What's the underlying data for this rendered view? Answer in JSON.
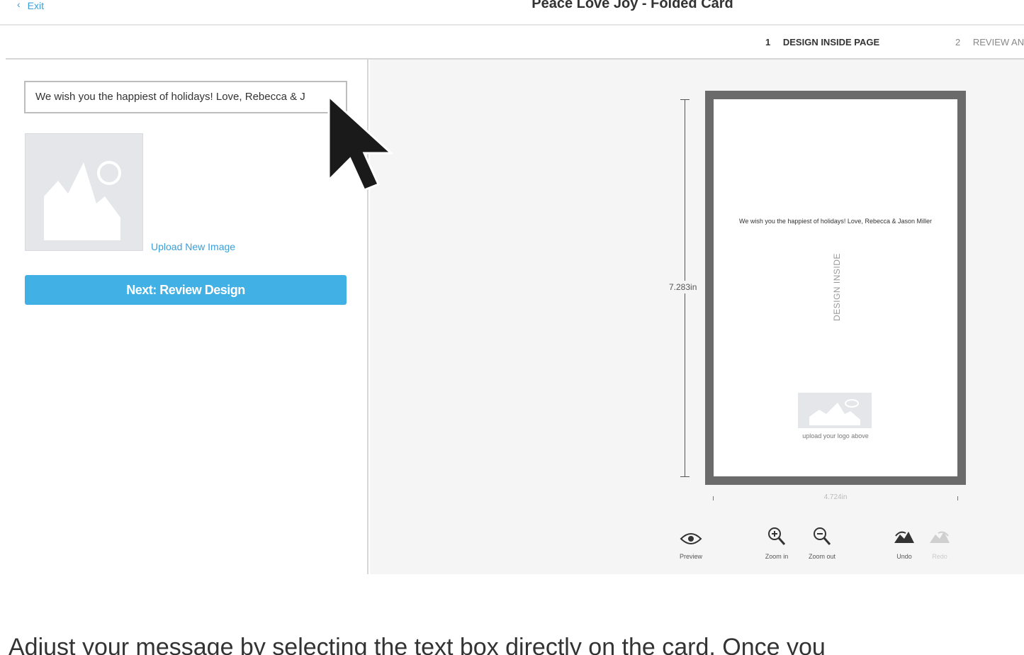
{
  "header": {
    "exit_label": "Exit",
    "title": "Peace Love Joy - Folded Card"
  },
  "steps": [
    {
      "number": "1",
      "label": "DESIGN INSIDE PAGE"
    },
    {
      "number": "2",
      "label": "REVIEW AND"
    }
  ],
  "editor": {
    "message_value": "We wish you the happiest of holidays! Love, Rebecca & J",
    "upload_label": "Upload New Image",
    "next_button_label": "Next: Review Design"
  },
  "preview": {
    "height_label": "7.283in",
    "width_label": "4.724in",
    "card_message": "We wish you the happiest of holidays! Love, Rebecca & Jason Miller",
    "vertical_label": "DESIGN INSIDE",
    "logo_caption": "upload your logo above"
  },
  "toolbar": {
    "preview": "Preview",
    "zoom_in": "Zoom in",
    "zoom_out": "Zoom out",
    "undo": "Undo",
    "redo": "Redo"
  },
  "colors": {
    "accent": "#41b0e4",
    "link": "#3a9fd8",
    "card_border": "#6b6b6b",
    "placeholder": "#e4e6e9"
  },
  "icons": [
    "chevron-left-icon",
    "image-placeholder-icon",
    "eye-icon",
    "zoom-in-icon",
    "zoom-out-icon",
    "undo-icon",
    "redo-icon",
    "mouse-cursor-icon"
  ],
  "caption": "Adjust your message by selecting the text box directly on the card. Once you"
}
